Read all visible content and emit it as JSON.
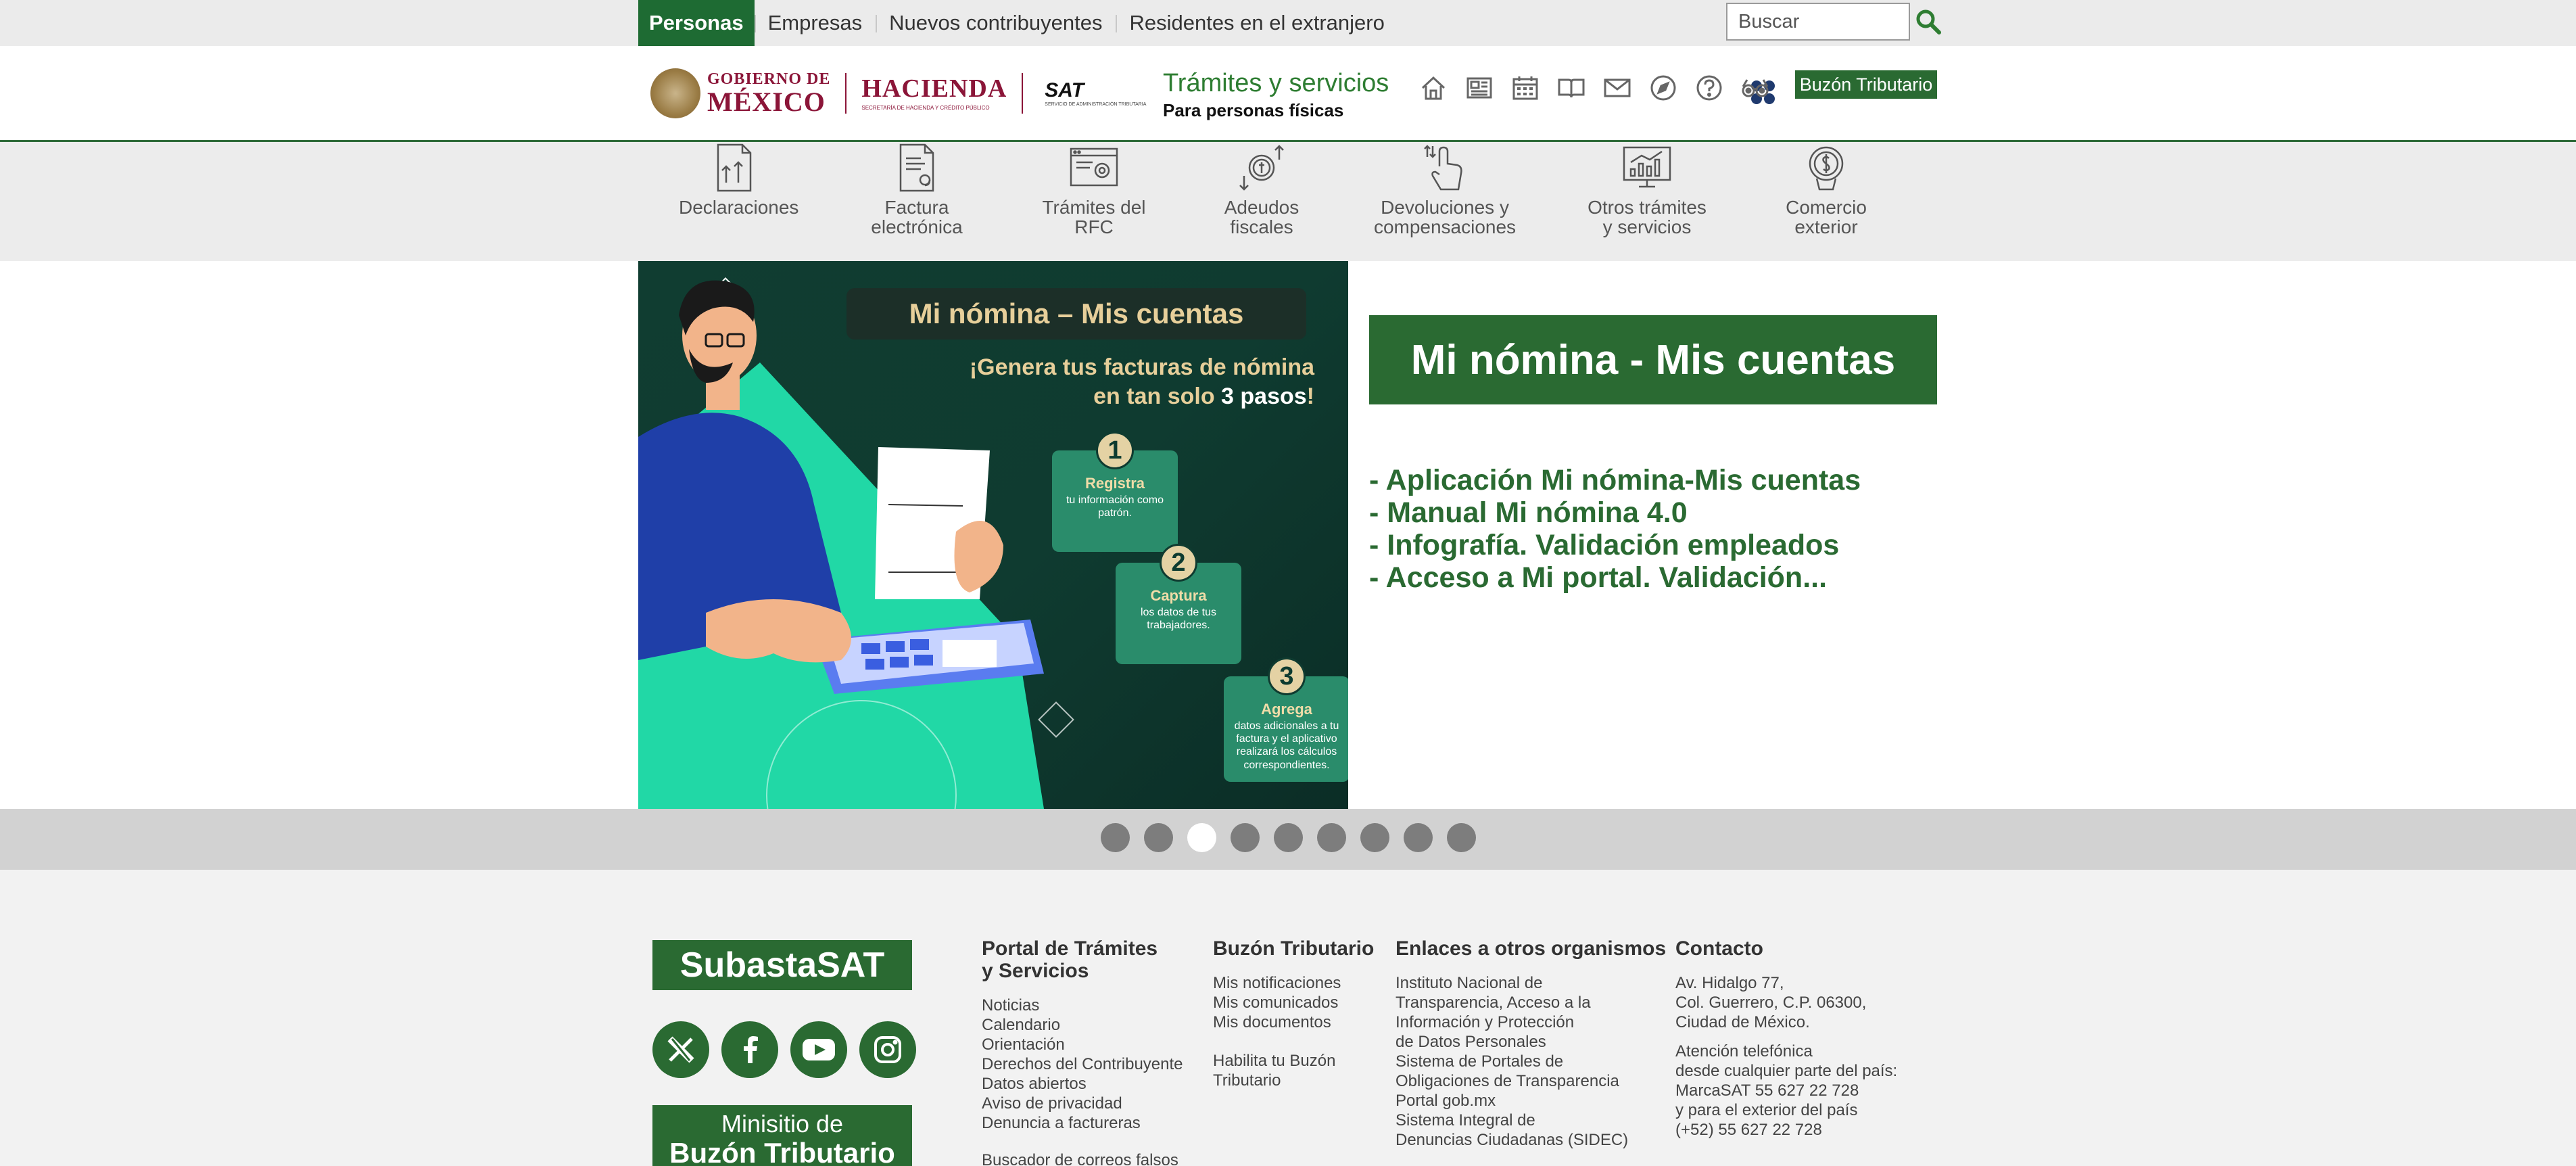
{
  "topbar": {
    "tabs": [
      "Personas",
      "Empresas",
      "Nuevos contribuyentes",
      "Residentes en el extranjero"
    ],
    "search_placeholder": "Buscar"
  },
  "header": {
    "gob_line1": "GOBIERNO DE",
    "gob_line2": "MÉXICO",
    "hacienda": "HACIENDA",
    "hacienda_sub": "SECRETARÍA DE HACIENDA Y CRÉDITO PÚBLICO",
    "sat": "SAT",
    "sat_sub": "SERVICIO DE ADMINISTRACIÓN TRIBUTARIA",
    "title": "Trámites y servicios",
    "subtitle": "Para personas físicas",
    "icons": [
      "home-icon",
      "news-icon",
      "calendar-icon",
      "book-icon",
      "mail-icon",
      "compass-icon",
      "help-icon",
      "glasses-icon"
    ],
    "buzon_button": "Buzón Tributario"
  },
  "categories": [
    {
      "line1": "Declaraciones",
      "line2": "",
      "icon": "declaraciones-icon"
    },
    {
      "line1": "Factura",
      "line2": "electrónica",
      "icon": "factura-icon"
    },
    {
      "line1": "Trámites del",
      "line2": "RFC",
      "icon": "rfc-icon"
    },
    {
      "line1": "Adeudos",
      "line2": "fiscales",
      "icon": "adeudos-icon"
    },
    {
      "line1": "Devoluciones y",
      "line2": "compensaciones",
      "icon": "devoluciones-icon"
    },
    {
      "line1": "Otros trámites",
      "line2": "y servicios",
      "icon": "otros-tramites-icon"
    },
    {
      "line1": "Comercio",
      "line2": "exterior",
      "icon": "comercio-exterior-icon"
    }
  ],
  "banner": {
    "title": "Mi nómina – Mis cuentas",
    "sub_line1": "¡Genera tus facturas de nómina",
    "sub_line2_pre": "en tan solo ",
    "sub_line2_bold": "3 pasos",
    "sub_line2_post": "!",
    "steps": [
      {
        "num": "1",
        "head": "Registra",
        "desc": "tu información como patrón."
      },
      {
        "num": "2",
        "head": "Captura",
        "desc": "los datos de tus trabajadores."
      },
      {
        "num": "3",
        "head": "Agrega",
        "desc": "datos adicionales a tu factura y el aplicativo realizará los cálculos correspondientes."
      }
    ]
  },
  "hero": {
    "heading": "Mi nómina - Mis cuentas",
    "links": [
      "- Aplicación Mi nómina-Mis cuentas",
      "- Manual Mi nómina 4.0",
      "- Infografía. Validación empleados",
      "- Acceso a Mi portal. Validación..."
    ]
  },
  "carousel": {
    "count": 9,
    "active_index": 2
  },
  "footer": {
    "subasta": "SubastaSAT",
    "social": [
      "x-icon",
      "facebook-icon",
      "youtube-icon",
      "instagram-icon"
    ],
    "minisitio_line1": "Minisitio de",
    "minisitio_line2": "Buzón Tributario",
    "col1": {
      "heading_line1": "Portal de Trámites",
      "heading_line2": "y Servicios",
      "links": [
        "Noticias",
        "Calendario",
        "Orientación",
        "Derechos del Contribuyente",
        "Datos abiertos",
        "Aviso de privacidad",
        "Denuncia a factureras"
      ],
      "extra": "Buscador de correos falsos"
    },
    "col2": {
      "heading": "Buzón Tributario",
      "links": [
        "Mis notificaciones",
        "Mis comunicados",
        "Mis documentos"
      ],
      "link2_line1": "Habilita tu Buzón",
      "link2_line2": "Tributario"
    },
    "col3": {
      "heading": "Enlaces a otros organismos",
      "lines": [
        "Instituto Nacional de",
        "Transparencia, Acceso a la",
        "Información y Protección",
        "de Datos Personales",
        "Sistema de Portales de",
        "Obligaciones de Transparencia",
        "Portal gob.mx",
        "Sistema Integral de",
        "Denuncias Ciudadanas (SIDEC)"
      ]
    },
    "col4": {
      "heading": "Contacto",
      "address": [
        "Av. Hidalgo 77,",
        "Col. Guerrero, C.P. 06300,",
        "Ciudad de México."
      ],
      "phone": [
        "Atención telefónica",
        "desde cualquier parte del país:",
        "MarcaSAT 55 627 22 728",
        "y para el exterior del país",
        "(+52) 55 627 22 728"
      ]
    }
  }
}
